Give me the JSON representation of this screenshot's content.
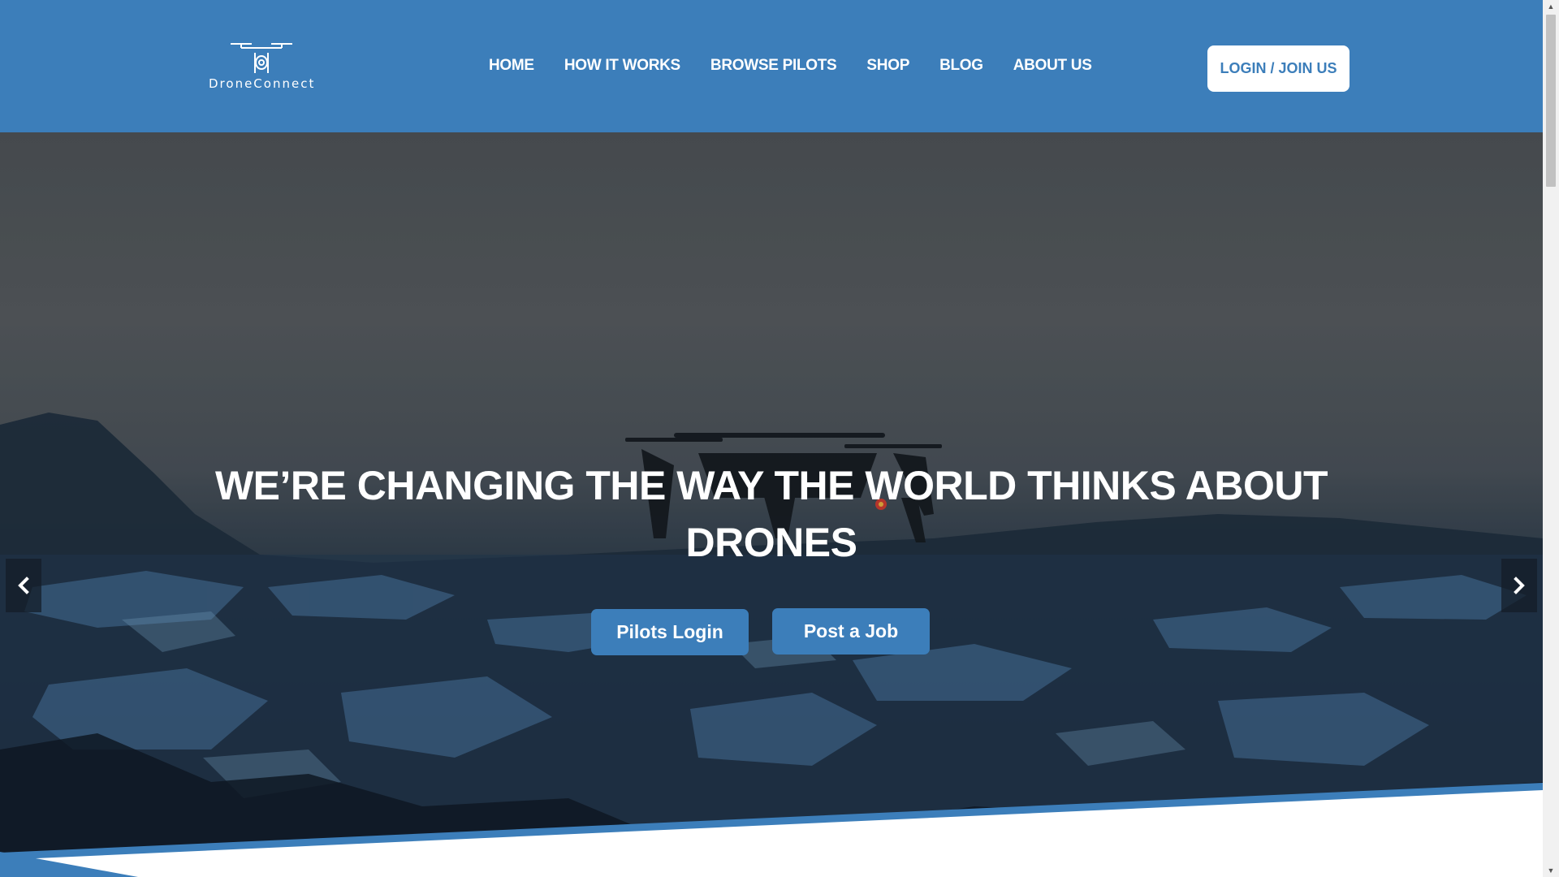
{
  "brand": {
    "name": "DroneConnect",
    "logo_icon": "drone-icon"
  },
  "nav": {
    "items": [
      {
        "label": "HOME"
      },
      {
        "label": "HOW IT WORKS"
      },
      {
        "label": "BROWSE PILOTS"
      },
      {
        "label": "SHOP"
      },
      {
        "label": "BLOG"
      },
      {
        "label": "ABOUT US"
      }
    ],
    "login_label": "LOGIN / JOIN US"
  },
  "hero": {
    "title": "WE’RE CHANGING THE WAY THE WORLD THINKS ABOUT DRONES",
    "buttons": {
      "pilots_login": "Pilots Login",
      "post_job": "Post a Job"
    },
    "prev_icon": "chevron-left-icon",
    "next_icon": "chevron-right-icon"
  },
  "colors": {
    "brand_blue": "#3c7eba",
    "white": "#ffffff"
  }
}
